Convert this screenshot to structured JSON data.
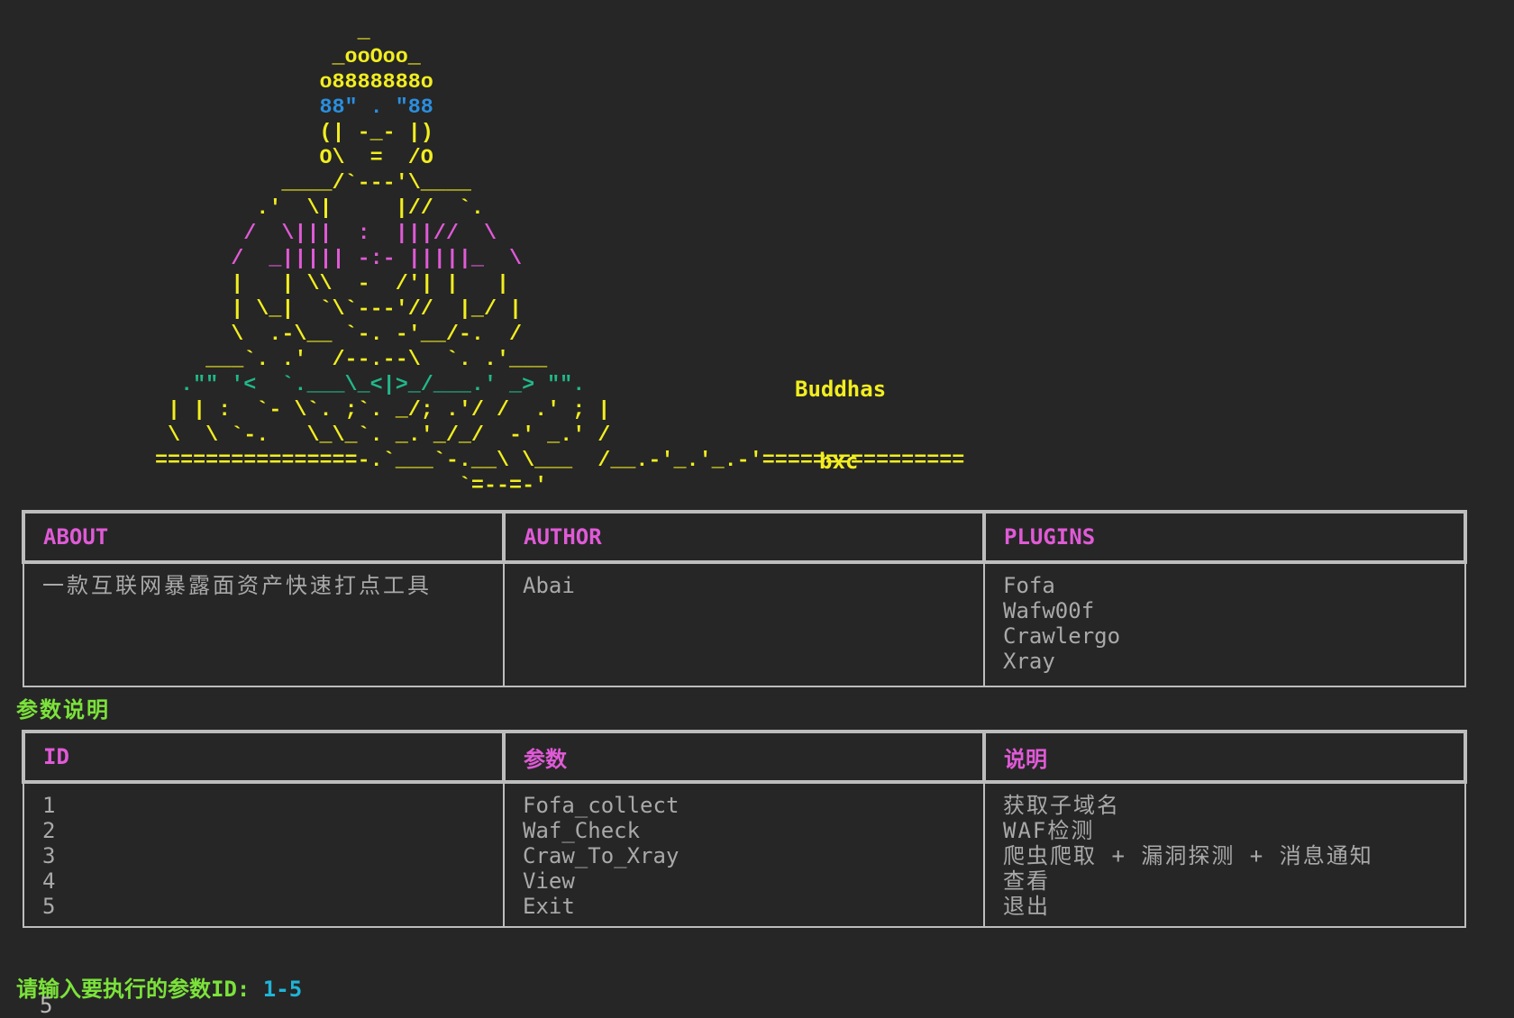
{
  "banner": {
    "art_lines": [
      "                _",
      "              _ooOoo_",
      "             o8888888o",
      "             88\" . \"88",
      "             (| -_- |)",
      "             O\\  =  /O",
      "          ____/`---'\\____",
      "        .'  \\|     |//  `.",
      "       /  \\|||  :  |||//  \\",
      "      /  _||||| -:- |||||_  \\",
      "      |   | \\\\  -  /'| |   |",
      "      | \\_|  `\\`---'//  |_/ |",
      "      \\  .-\\__ `-. -'__/-.  /",
      "    ___`. .'  /--.--\\  `. .'___",
      "  .\"\" '<  `.___\\_<|>_/___.' _> \"\".",
      " | | :  `- \\`. ;`. _/; .'/ /  .' ; |",
      " \\  \\ `-.   \\_\\_`. _.'_/_/  -' _.' /",
      "================-.`___`-.__\\ \\___  /__.-'_.'_.-'================",
      "                        `=--=-'"
    ],
    "label_top": "Buddhas",
    "label_bottom": "bxc"
  },
  "info_table": {
    "headers": [
      "ABOUT",
      "AUTHOR",
      "PLUGINS"
    ],
    "about": "一款互联网暴露面资产快速打点工具",
    "author": "Abai",
    "plugins": [
      "Fofa",
      "Wafw00f",
      "Crawlergo",
      "Xray"
    ]
  },
  "params_section_title": "参数说明",
  "params_table": {
    "headers": [
      "ID",
      "参数",
      "说明"
    ],
    "rows": [
      {
        "id": "1",
        "param": "Fofa_collect",
        "desc": "获取子域名"
      },
      {
        "id": "2",
        "param": "Waf_Check",
        "desc": "WAF检测"
      },
      {
        "id": "3",
        "param": "Craw_To_Xray",
        "desc": "爬虫爬取 + 漏洞探测 + 消息通知"
      },
      {
        "id": "4",
        "param": "View",
        "desc": "查看"
      },
      {
        "id": "5",
        "param": "Exit",
        "desc": "退出"
      }
    ]
  },
  "prompt": {
    "text": "请输入要执行的参数ID: ",
    "range": "1-5",
    "input_value": "5"
  },
  "colors": {
    "background": "#262626",
    "yellow": "#f2ee1f",
    "magenta": "#e05ad7",
    "green": "#7be23a",
    "cyan": "#1fb5d8",
    "blue": "#2a8fe0",
    "teal": "#21b889"
  }
}
